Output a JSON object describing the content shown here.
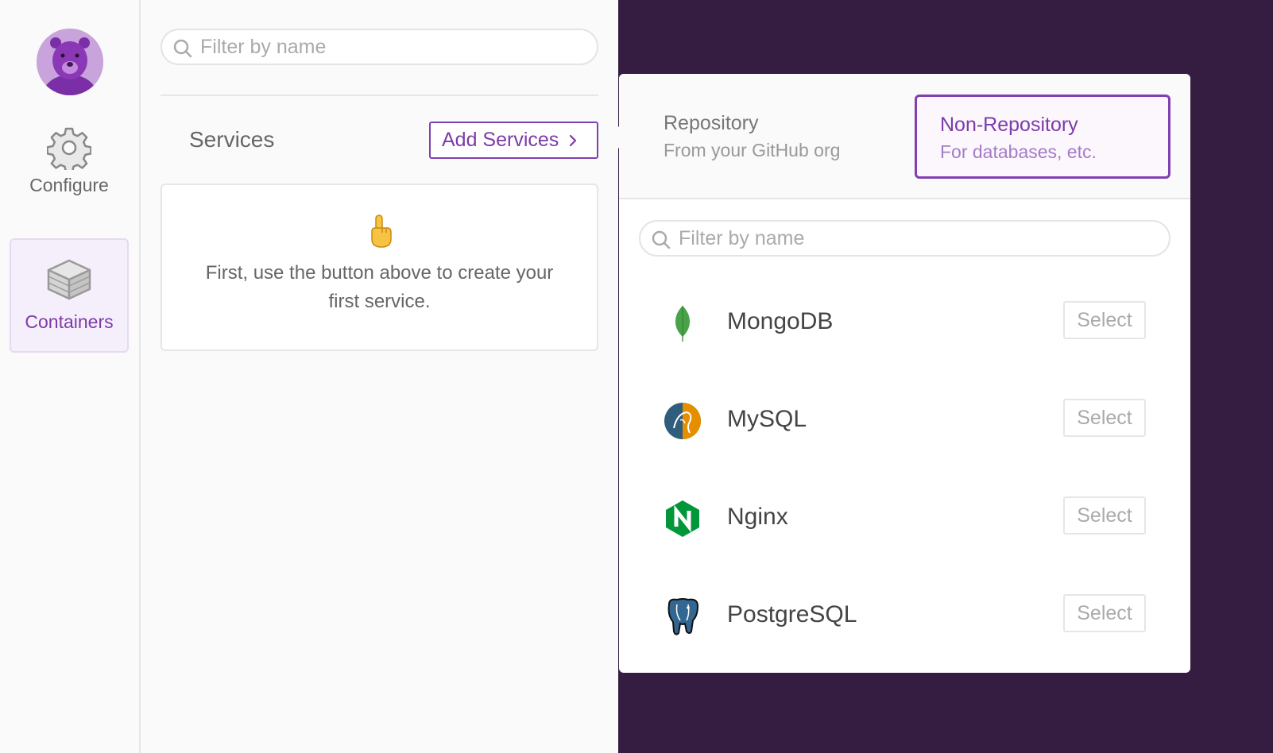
{
  "nav": {
    "items": [
      {
        "label": "Configure",
        "icon": "gear-icon",
        "active": false
      },
      {
        "label": "Containers",
        "icon": "box-icon",
        "active": true
      }
    ]
  },
  "services_panel": {
    "search_placeholder": "Filter by name",
    "title": "Services",
    "add_button_label": "Add Services",
    "empty_emoji": "👆",
    "empty_message": "First, use the button above to create your first service."
  },
  "popover": {
    "tabs": [
      {
        "title": "Repository",
        "subtitle": "From your GitHub org",
        "selected": false
      },
      {
        "title": "Non-Repository",
        "subtitle": "For databases, etc.",
        "selected": true
      }
    ],
    "search_placeholder": "Filter by name",
    "services": [
      {
        "name": "MongoDB",
        "icon": "mongodb-logo-icon",
        "action": "Select"
      },
      {
        "name": "MySQL",
        "icon": "mysql-logo-icon",
        "action": "Select"
      },
      {
        "name": "Nginx",
        "icon": "nginx-logo-icon",
        "action": "Select"
      },
      {
        "name": "PostgreSQL",
        "icon": "postgresql-logo-icon",
        "action": "Select"
      }
    ]
  },
  "colors": {
    "accent": "#7d3ba8",
    "backdrop": "#341d41",
    "panel": "#fafafa"
  }
}
